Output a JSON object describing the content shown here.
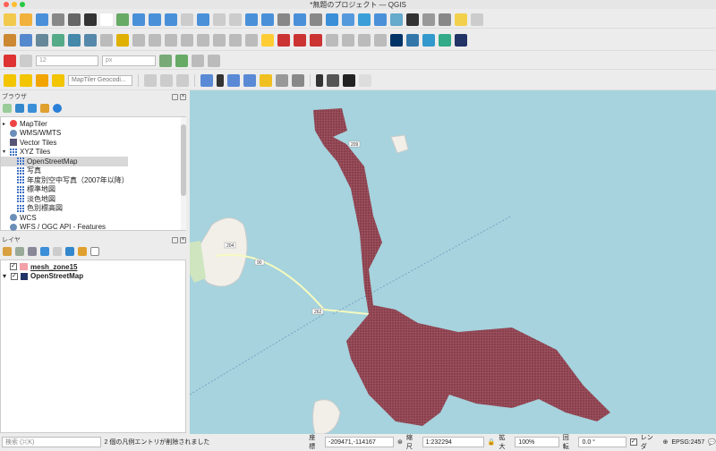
{
  "window": {
    "title": "*無題のプロジェクト — QGIS"
  },
  "toolbar": {
    "scale_value": "12",
    "unit": "px",
    "geocoder_placeholder": "MapTiler Geocodi..."
  },
  "browser": {
    "title": "ブラウザ",
    "items": [
      {
        "label": "MapTiler",
        "icon": "maptiler-icon",
        "indent": 0,
        "arrow": "▸"
      },
      {
        "label": "WMS/WMTS",
        "icon": "globe-icon",
        "indent": 0
      },
      {
        "label": "Vector Tiles",
        "icon": "vector-tiles-icon",
        "indent": 0
      },
      {
        "label": "XYZ Tiles",
        "icon": "xyz-tiles-icon",
        "indent": 0,
        "arrow": "▾"
      },
      {
        "label": "OpenStreetMap",
        "icon": "tile-grid-icon",
        "indent": 1,
        "selected": true
      },
      {
        "label": "写真",
        "icon": "tile-grid-icon",
        "indent": 1
      },
      {
        "label": "年度別空中写真（2007年以降）",
        "icon": "tile-grid-icon",
        "indent": 1
      },
      {
        "label": "標準地図",
        "icon": "tile-grid-icon",
        "indent": 1
      },
      {
        "label": "淡色地図",
        "icon": "tile-grid-icon",
        "indent": 1
      },
      {
        "label": "色別標高図",
        "icon": "tile-grid-icon",
        "indent": 1
      },
      {
        "label": "WCS",
        "icon": "globe-icon",
        "indent": 0
      },
      {
        "label": "WFS / OGC API - Features",
        "icon": "globe-icon",
        "indent": 0
      }
    ]
  },
  "layers": {
    "title": "レイヤ",
    "items": [
      {
        "label": "mesh_zone15",
        "checked": true
      },
      {
        "label": "OpenStreetMap",
        "checked": true
      }
    ]
  },
  "map": {
    "road_labels": [
      "209",
      "204",
      "90",
      "262"
    ],
    "colors": {
      "water": "#a6d3dd",
      "land": "#f2efe9",
      "mesh": "#8a3f4d"
    }
  },
  "statusbar": {
    "search_placeholder": "検索 (⌘K)",
    "message": "2 個の凡例エントリが削除されました",
    "coord_label": "座標",
    "coord_value": "-209471,-114167",
    "scale_label": "縮尺",
    "scale_value": "1:232294",
    "magnifier_label": "拡大",
    "magnifier_value": "100%",
    "rotation_label": "回転",
    "rotation_value": "0.0 °",
    "render_label": "レンダ",
    "crs": "EPSG:2457"
  }
}
